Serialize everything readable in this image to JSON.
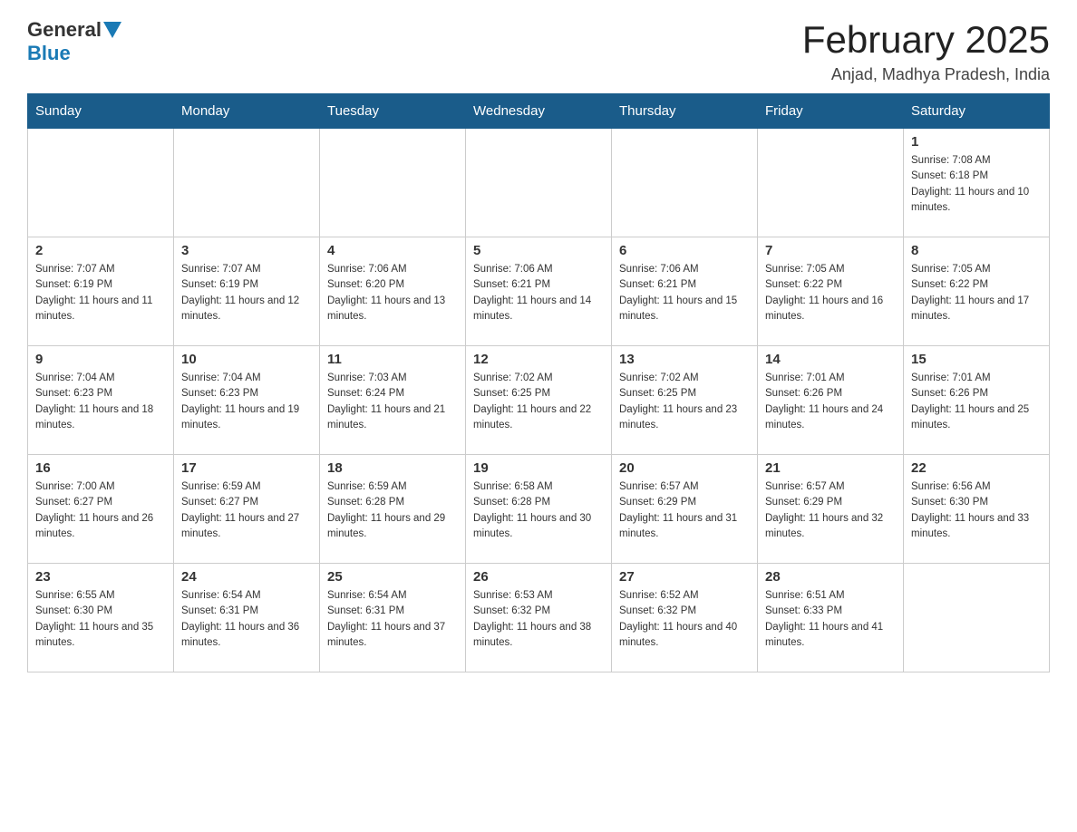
{
  "logo": {
    "general": "General",
    "blue": "Blue"
  },
  "title": "February 2025",
  "subtitle": "Anjad, Madhya Pradesh, India",
  "weekdays": [
    "Sunday",
    "Monday",
    "Tuesday",
    "Wednesday",
    "Thursday",
    "Friday",
    "Saturday"
  ],
  "weeks": [
    [
      {
        "day": "",
        "info": ""
      },
      {
        "day": "",
        "info": ""
      },
      {
        "day": "",
        "info": ""
      },
      {
        "day": "",
        "info": ""
      },
      {
        "day": "",
        "info": ""
      },
      {
        "day": "",
        "info": ""
      },
      {
        "day": "1",
        "info": "Sunrise: 7:08 AM\nSunset: 6:18 PM\nDaylight: 11 hours and 10 minutes."
      }
    ],
    [
      {
        "day": "2",
        "info": "Sunrise: 7:07 AM\nSunset: 6:19 PM\nDaylight: 11 hours and 11 minutes."
      },
      {
        "day": "3",
        "info": "Sunrise: 7:07 AM\nSunset: 6:19 PM\nDaylight: 11 hours and 12 minutes."
      },
      {
        "day": "4",
        "info": "Sunrise: 7:06 AM\nSunset: 6:20 PM\nDaylight: 11 hours and 13 minutes."
      },
      {
        "day": "5",
        "info": "Sunrise: 7:06 AM\nSunset: 6:21 PM\nDaylight: 11 hours and 14 minutes."
      },
      {
        "day": "6",
        "info": "Sunrise: 7:06 AM\nSunset: 6:21 PM\nDaylight: 11 hours and 15 minutes."
      },
      {
        "day": "7",
        "info": "Sunrise: 7:05 AM\nSunset: 6:22 PM\nDaylight: 11 hours and 16 minutes."
      },
      {
        "day": "8",
        "info": "Sunrise: 7:05 AM\nSunset: 6:22 PM\nDaylight: 11 hours and 17 minutes."
      }
    ],
    [
      {
        "day": "9",
        "info": "Sunrise: 7:04 AM\nSunset: 6:23 PM\nDaylight: 11 hours and 18 minutes."
      },
      {
        "day": "10",
        "info": "Sunrise: 7:04 AM\nSunset: 6:23 PM\nDaylight: 11 hours and 19 minutes."
      },
      {
        "day": "11",
        "info": "Sunrise: 7:03 AM\nSunset: 6:24 PM\nDaylight: 11 hours and 21 minutes."
      },
      {
        "day": "12",
        "info": "Sunrise: 7:02 AM\nSunset: 6:25 PM\nDaylight: 11 hours and 22 minutes."
      },
      {
        "day": "13",
        "info": "Sunrise: 7:02 AM\nSunset: 6:25 PM\nDaylight: 11 hours and 23 minutes."
      },
      {
        "day": "14",
        "info": "Sunrise: 7:01 AM\nSunset: 6:26 PM\nDaylight: 11 hours and 24 minutes."
      },
      {
        "day": "15",
        "info": "Sunrise: 7:01 AM\nSunset: 6:26 PM\nDaylight: 11 hours and 25 minutes."
      }
    ],
    [
      {
        "day": "16",
        "info": "Sunrise: 7:00 AM\nSunset: 6:27 PM\nDaylight: 11 hours and 26 minutes."
      },
      {
        "day": "17",
        "info": "Sunrise: 6:59 AM\nSunset: 6:27 PM\nDaylight: 11 hours and 27 minutes."
      },
      {
        "day": "18",
        "info": "Sunrise: 6:59 AM\nSunset: 6:28 PM\nDaylight: 11 hours and 29 minutes."
      },
      {
        "day": "19",
        "info": "Sunrise: 6:58 AM\nSunset: 6:28 PM\nDaylight: 11 hours and 30 minutes."
      },
      {
        "day": "20",
        "info": "Sunrise: 6:57 AM\nSunset: 6:29 PM\nDaylight: 11 hours and 31 minutes."
      },
      {
        "day": "21",
        "info": "Sunrise: 6:57 AM\nSunset: 6:29 PM\nDaylight: 11 hours and 32 minutes."
      },
      {
        "day": "22",
        "info": "Sunrise: 6:56 AM\nSunset: 6:30 PM\nDaylight: 11 hours and 33 minutes."
      }
    ],
    [
      {
        "day": "23",
        "info": "Sunrise: 6:55 AM\nSunset: 6:30 PM\nDaylight: 11 hours and 35 minutes."
      },
      {
        "day": "24",
        "info": "Sunrise: 6:54 AM\nSunset: 6:31 PM\nDaylight: 11 hours and 36 minutes."
      },
      {
        "day": "25",
        "info": "Sunrise: 6:54 AM\nSunset: 6:31 PM\nDaylight: 11 hours and 37 minutes."
      },
      {
        "day": "26",
        "info": "Sunrise: 6:53 AM\nSunset: 6:32 PM\nDaylight: 11 hours and 38 minutes."
      },
      {
        "day": "27",
        "info": "Sunrise: 6:52 AM\nSunset: 6:32 PM\nDaylight: 11 hours and 40 minutes."
      },
      {
        "day": "28",
        "info": "Sunrise: 6:51 AM\nSunset: 6:33 PM\nDaylight: 11 hours and 41 minutes."
      },
      {
        "day": "",
        "info": ""
      }
    ]
  ]
}
